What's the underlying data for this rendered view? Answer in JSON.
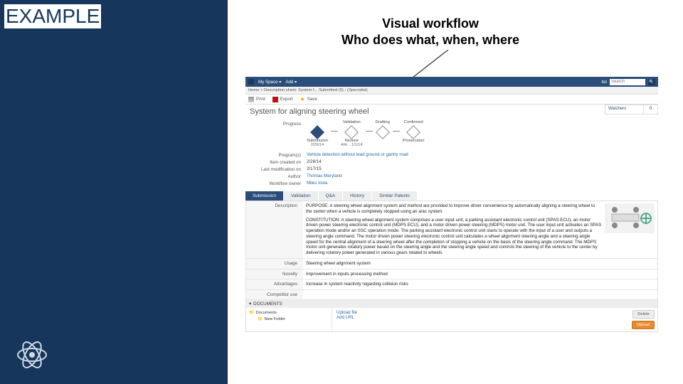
{
  "slide": {
    "example_label": "EXAMPLE",
    "title_line1": "Visual workflow",
    "title_line2": "Who does what, when, where"
  },
  "topbar": {
    "myspace": "My Space ▾",
    "add": "Add ▾",
    "list_label": "list",
    "search_placeholder": "Search"
  },
  "breadcrumb": "Home > Description sheet: System f... Submitted (5) › (Specialist)",
  "tools": {
    "print": "Print",
    "export": "Export",
    "save": "Save"
  },
  "page_title": "System for aligning steering wheel",
  "watchers": {
    "label": "Watchers",
    "count": "0"
  },
  "progress": {
    "label": "Progress",
    "stages": [
      {
        "top": "",
        "name": "Submission",
        "date": "2/26/14",
        "active": true
      },
      {
        "top": "Validation",
        "name": "Review",
        "date": "4/4/... 1/1/14",
        "active": false
      },
      {
        "top": "Drafting",
        "name": "",
        "date": "",
        "active": false
      },
      {
        "top": "Confirmed",
        "name": "Prosecution",
        "date": "",
        "active": false
      }
    ]
  },
  "info": {
    "program_label": "Program(s)",
    "program_val": "Vehicle detection without lead ground or gantry road",
    "created_label": "Item created on",
    "created_val": "2/26/14",
    "mod_label": "Last modification on",
    "mod_val": "2/17/15",
    "author_label": "Author",
    "author_val": "Thomas Maryland",
    "owner_label": "Workflow owner",
    "owner_val": "Miles Iowa"
  },
  "tabs": [
    "Submission",
    "Validation",
    "Q&A",
    "History",
    "Similar Patents"
  ],
  "desc": {
    "label": "Description",
    "purpose": "PURPOSE: A steering wheel alignment system and method are provided to improve driver convenience by automatically aligning a steering wheel to the center when a vehicle is completely stopped using an a/ac system.",
    "constitution": "CONSTITUTION: A steering wheel alignment system comprises a user input unit, a parking assistant electronic control unit (SPAS ECU), an motor driven power steering electronic control unit (MDPS ECU), and a motor driven power steering (MDPS) motor unit. The user input unit activates an SPAS operation mode and/or an SSC operation mode. The parking assistant electronic control unit starts to operate with the input of a user and outputs a steering angle command. The motor driven power steering electronic control unit calculates a wheel alignment steering angle and a steering angle speed for the central alignment of a steering wheel after the completion of stopping a vehicle on the basis of the steering angle command. The MDPS motor unit generates rotatory power based on the steering angle and the steering angle speed and controls the steering of the vehicle to the center by delivering rotatory power generated in various gears related to wheels."
  },
  "rows": {
    "usage_label": "Usage",
    "usage_val": "Steering wheel alignment system",
    "novelty_label": "Novelty",
    "novelty_val": "Improvement in inputs processing method",
    "adv_label": "Advantages",
    "adv_val": "Increase in system reactivity regarding collision risks",
    "comp_label": "Competitor use",
    "comp_val": ""
  },
  "docs": {
    "header": "DOCUMENTS",
    "folder1": "Documents",
    "folder2": "New Folder",
    "upload": "Upload file",
    "addurl": "Add URL",
    "delete_btn": "Delete",
    "upload_btn": "Upload"
  }
}
